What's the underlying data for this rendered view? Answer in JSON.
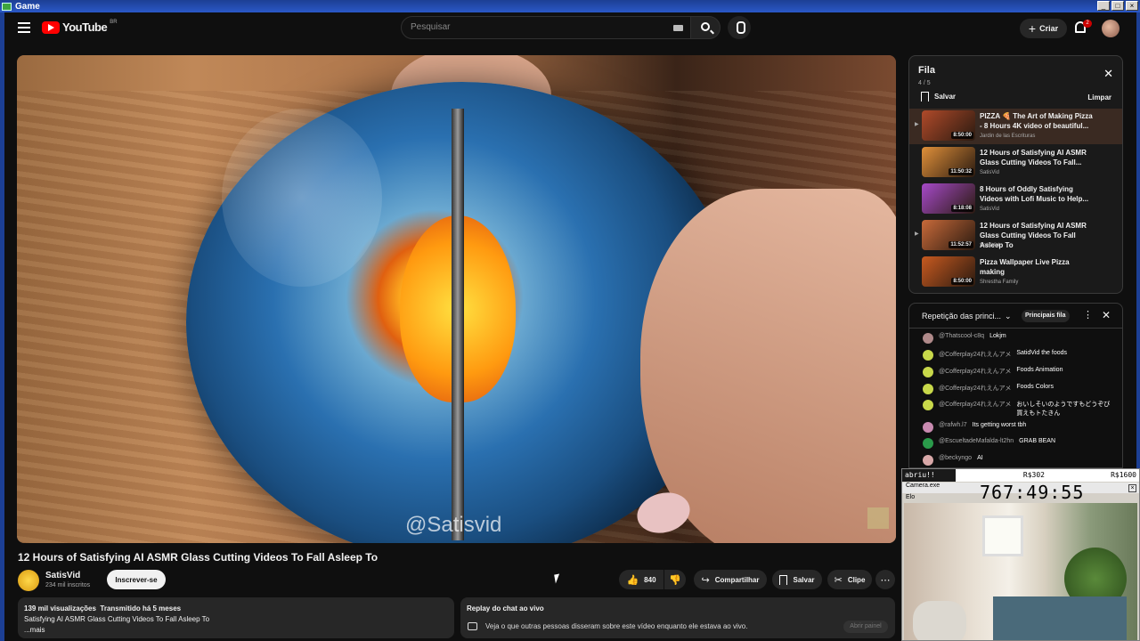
{
  "window": {
    "title": "Game",
    "buttons": [
      "_",
      "□",
      "×"
    ]
  },
  "header": {
    "logo": "YouTube",
    "region": "BR",
    "search_placeholder": "Pesquisar",
    "create_label": "Criar",
    "notification_count": "2"
  },
  "video": {
    "watermark": "@Satisvid",
    "title": "12 Hours of Satisfying AI ASMR Glass Cutting Videos To Fall Asleep To",
    "channel": "SatisVid",
    "subscribers": "234 mil inscritos",
    "subscribe_label": "Inscrever-se",
    "likes": "840",
    "share_label": "Compartilhar",
    "save_label": "Salvar",
    "clip_label": "Clipe"
  },
  "description": {
    "views": "139 mil visualizações",
    "streamed": "Transmitido há 5 meses",
    "text": "Satisfying AI ASMR Glass Cutting Videos To Fall Asleep To",
    "more": "...mais"
  },
  "chat_replay": {
    "title": "Replay do chat ao vivo",
    "text": "Veja o que outras pessoas disseram sobre este vídeo enquanto ele estava ao vivo.",
    "open_label": "Abrir painel"
  },
  "queue": {
    "title": "Fila",
    "count": "4 / 5",
    "save_label": "Salvar",
    "clear_label": "Limpar",
    "items": [
      {
        "title": "PIZZA 🍕 The Art of Making Pizza - 8 Hours 4K video of beautiful...",
        "channel": "Jardin de las Escrituras",
        "duration": "8:50:00",
        "active": true,
        "thumb": "#b04a2a"
      },
      {
        "title": "12 Hours of Satisfying AI ASMR Glass Cutting Videos To Fall...",
        "channel": "SatisVid",
        "duration": "11:50:32",
        "active": false,
        "thumb": "#e0903a"
      },
      {
        "title": "8 Hours of Oddly Satisfying Videos with Lofi Music to Help...",
        "channel": "SatisVid",
        "duration": "8:18:08",
        "active": false,
        "thumb": "#a64ac9"
      },
      {
        "title": "12 Hours of Satisfying AI ASMR Glass Cutting Videos To Fall Asleep To",
        "channel": "SatisVid",
        "duration": "11:52:57",
        "active": false,
        "thumb": "#c86a3a"
      },
      {
        "title": "Pizza Wallpaper Live Pizza making",
        "channel": "Shrestha Family",
        "duration": "8:50:00",
        "active": false,
        "thumb": "#c85a20"
      }
    ]
  },
  "live_chat": {
    "title": "Repetição das princi...",
    "chip": "Principais fila",
    "messages": [
      {
        "author": "@Thatscool-c8q",
        "text": "Lokjm",
        "color": "#b08a8a"
      },
      {
        "author": "@Cofferplay24れえんアメ",
        "text": "SatidVid the foods",
        "color": "#c8d84a"
      },
      {
        "author": "@Cofferplay24れえんアメ",
        "text": "Foods Animation",
        "color": "#c8d84a"
      },
      {
        "author": "@Cofferplay24れえんアメ",
        "text": "Foods Colors",
        "color": "#c8d84a"
      },
      {
        "author": "@Cofferplay24れえんアメ",
        "text": "おいしそいのようですもどうぞび買えもトたきん",
        "color": "#c8d84a"
      },
      {
        "author": "@rafwh.l7",
        "text": "Its getting worst tbh",
        "color": "#c88ab0"
      },
      {
        "author": "@EscueltadeMafalda-lt2hn",
        "text": "GRAB BEAN",
        "color": "#2a9a4a"
      },
      {
        "author": "@beckyngo",
        "text": "AI",
        "color": "#d8a8a8"
      }
    ]
  },
  "overlay": {
    "name": "abriu!!",
    "mid_value": "R$302",
    "right_value": "R$1600",
    "app_label": "Camera.exe",
    "clock": "767:49:55",
    "sub_label": "Elo"
  }
}
